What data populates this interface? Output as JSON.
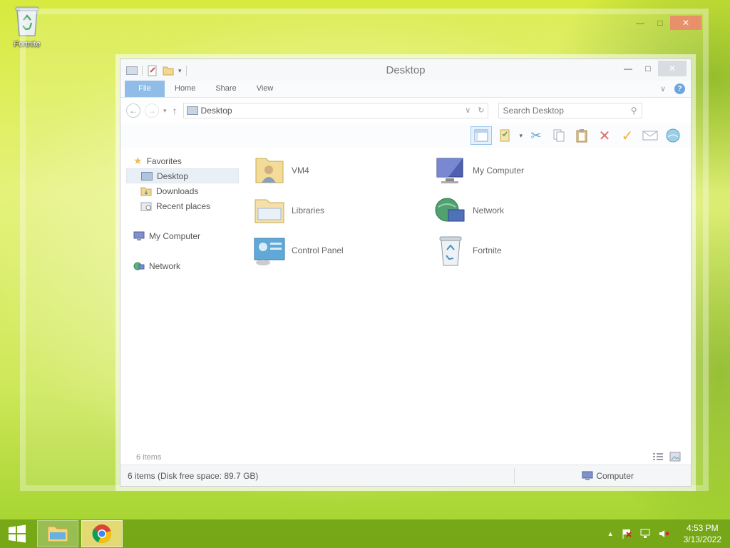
{
  "desktop": {
    "icons": [
      {
        "label": "Fortnite",
        "icon": "recycle-bin-icon"
      }
    ]
  },
  "window": {
    "title": "Desktop",
    "controls": {
      "minimize": "—",
      "maximize": "□",
      "close": "✕"
    },
    "ribbon_tabs": [
      {
        "label": "File"
      },
      {
        "label": "Home"
      },
      {
        "label": "Share"
      },
      {
        "label": "View"
      }
    ],
    "help": "?",
    "address": {
      "value": "Desktop"
    },
    "search": {
      "placeholder": "Search Desktop"
    },
    "navigation": {
      "favorites": "Favorites",
      "favorites_items": [
        "Desktop",
        "Downloads",
        "Recent places"
      ],
      "my_computer": "My Computer",
      "network": "Network"
    },
    "items": [
      {
        "label": "VM4",
        "icon": "user-folder-icon"
      },
      {
        "label": "My Computer",
        "icon": "computer-icon"
      },
      {
        "label": "Libraries",
        "icon": "libraries-icon"
      },
      {
        "label": "Network",
        "icon": "network-icon"
      },
      {
        "label": "Control Panel",
        "icon": "control-panel-icon"
      },
      {
        "label": "Fortnite",
        "icon": "recycle-bin-icon"
      }
    ],
    "item_count": "6 items",
    "status": {
      "left": "6 items (Disk free space: 89.7 GB)",
      "right": "Computer"
    }
  },
  "taskbar": {
    "clock_time": "4:53 PM",
    "clock_date": "3/13/2022",
    "tray_chevron": "▲"
  },
  "colors": {
    "accent": "#8fbde8",
    "taskbar": "#6ea014"
  }
}
